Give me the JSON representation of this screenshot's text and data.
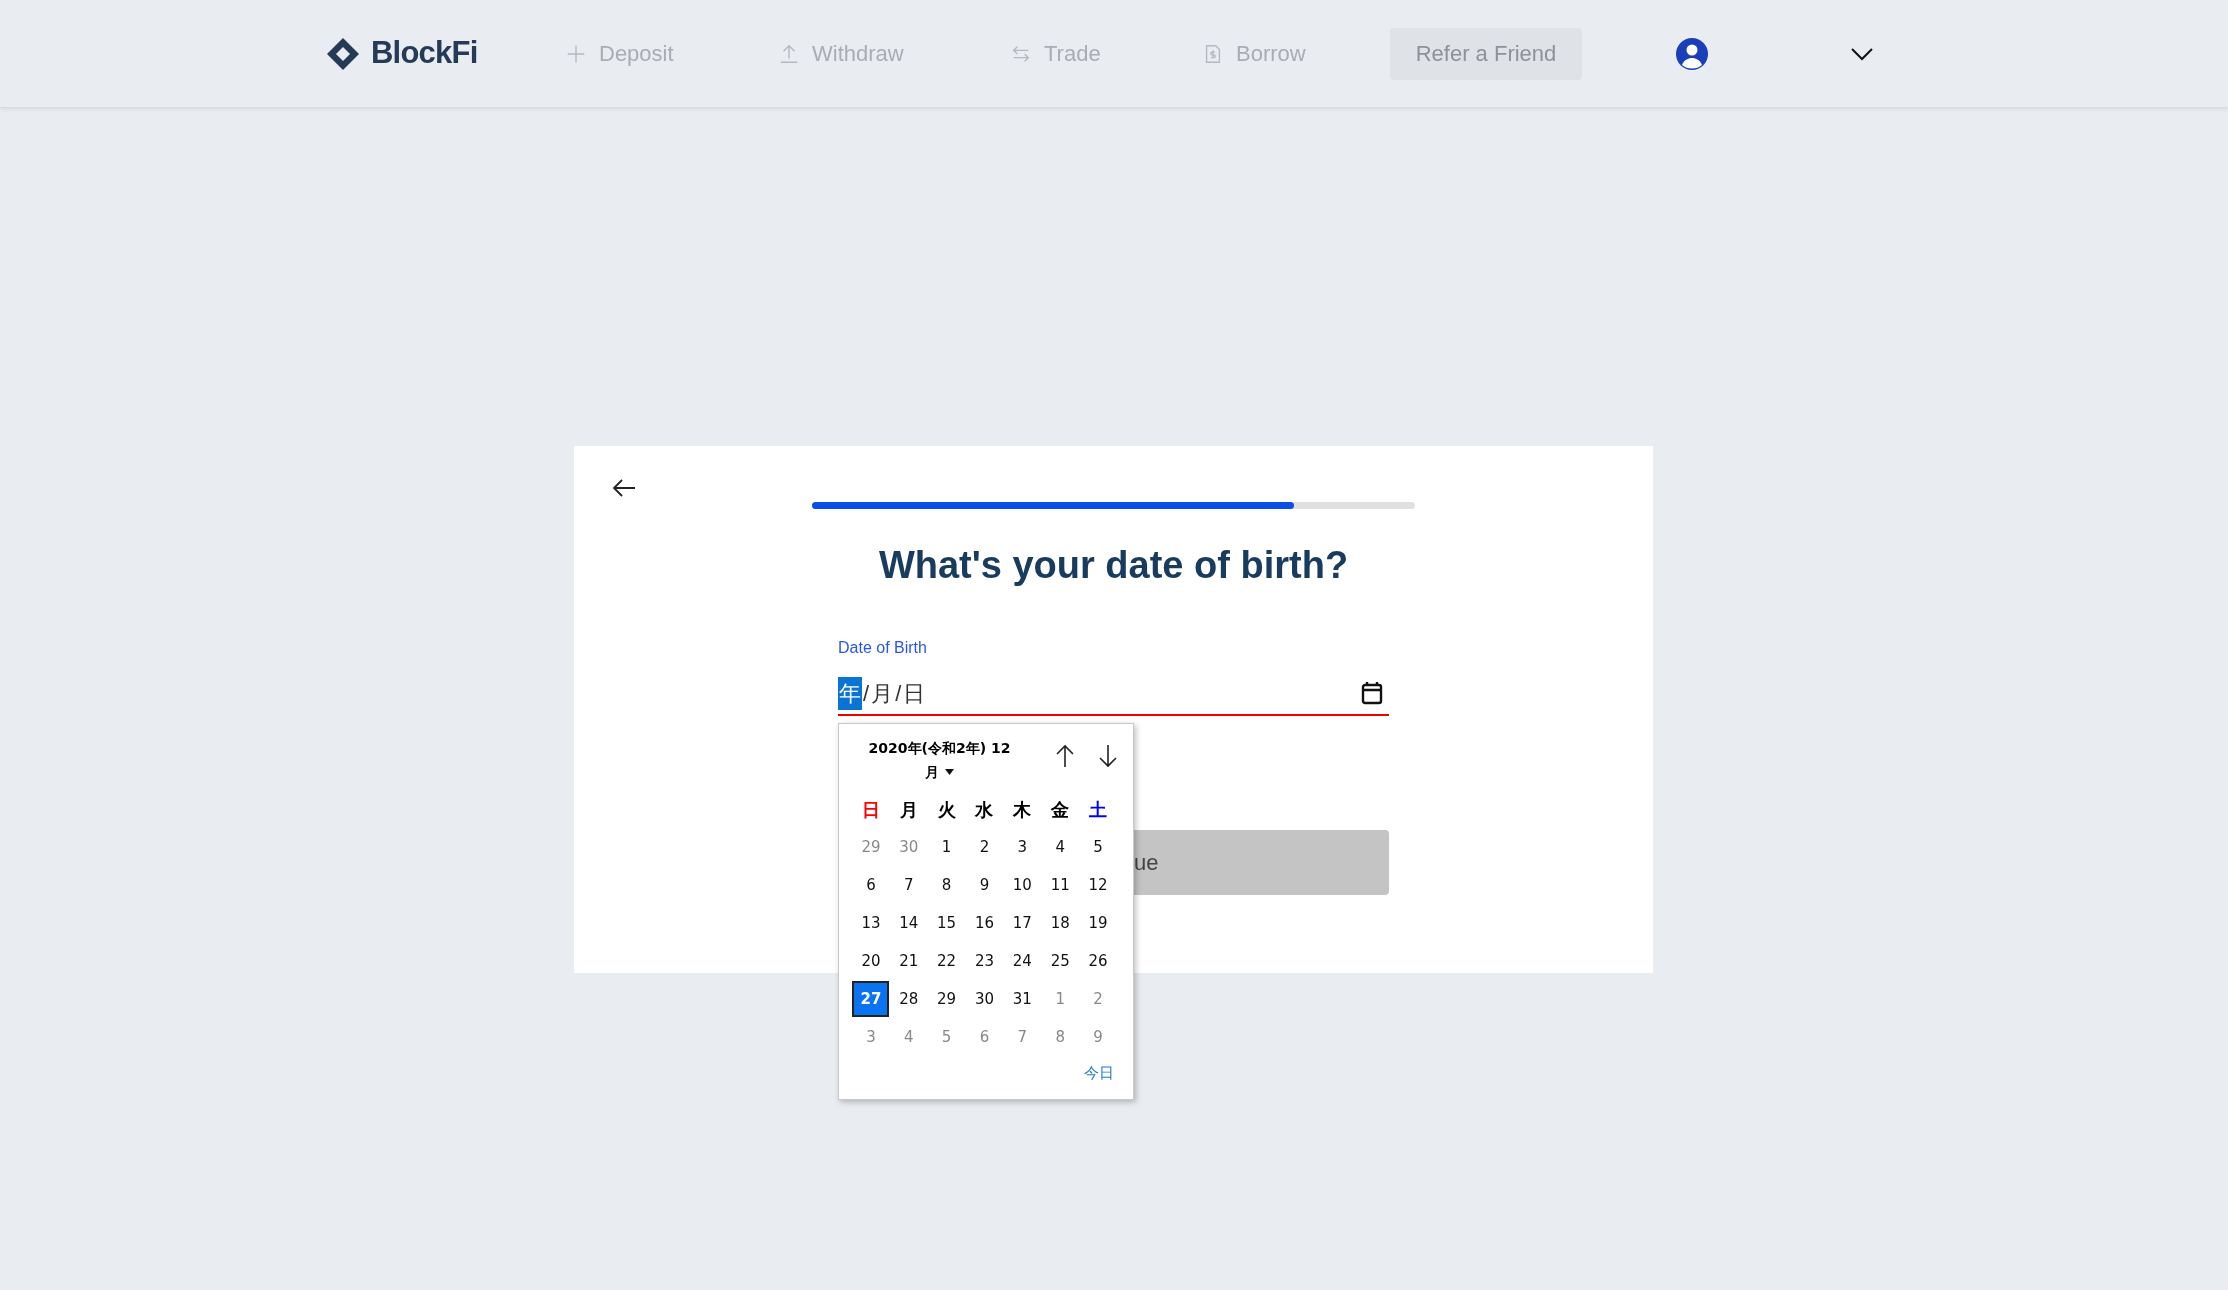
{
  "nav": {
    "logo": "BlockFi",
    "items": [
      {
        "label": "Deposit",
        "kind": "plus"
      },
      {
        "label": "Withdraw",
        "kind": "upload"
      },
      {
        "label": "Trade",
        "kind": "swap"
      },
      {
        "label": "Borrow",
        "kind": "doc"
      }
    ],
    "refer_button": "Refer a Friend"
  },
  "card": {
    "progress": {
      "level": 0.8
    },
    "title": "What's your date of birth?",
    "field": {
      "label": "Date of Birth",
      "segments": [
        {
          "text": "年",
          "selected": true
        },
        {
          "text": "/",
          "selected": false
        },
        {
          "text": "月",
          "selected": false
        },
        {
          "text": "/",
          "selected": false
        },
        {
          "text": "日",
          "selected": false
        }
      ]
    },
    "continue_button": "ue"
  },
  "calendar": {
    "header_line1": "2020年(令和2年) 12",
    "header_line2": "月",
    "weekdays": [
      {
        "label": "日",
        "color": "#ff0000"
      },
      {
        "label": "月",
        "color": "#000000"
      },
      {
        "label": "火",
        "color": "#000000"
      },
      {
        "label": "水",
        "color": "#000000"
      },
      {
        "label": "木",
        "color": "#000000"
      },
      {
        "label": "金",
        "color": "#000000"
      },
      {
        "label": "土",
        "color": "#0000ff"
      }
    ],
    "weeks": [
      [
        {
          "day": "29",
          "kind": "other",
          "selected": false
        },
        {
          "day": "30",
          "kind": "other",
          "selected": false
        },
        {
          "day": "1",
          "kind": "current",
          "selected": false
        },
        {
          "day": "2",
          "kind": "current",
          "selected": false
        },
        {
          "day": "3",
          "kind": "current",
          "selected": false
        },
        {
          "day": "4",
          "kind": "current",
          "selected": false
        },
        {
          "day": "5",
          "kind": "current",
          "selected": false
        }
      ],
      [
        {
          "day": "6",
          "kind": "current",
          "selected": false
        },
        {
          "day": "7",
          "kind": "current",
          "selected": false
        },
        {
          "day": "8",
          "kind": "current",
          "selected": false
        },
        {
          "day": "9",
          "kind": "current",
          "selected": false
        },
        {
          "day": "10",
          "kind": "current",
          "selected": false
        },
        {
          "day": "11",
          "kind": "current",
          "selected": false
        },
        {
          "day": "12",
          "kind": "current",
          "selected": false
        }
      ],
      [
        {
          "day": "13",
          "kind": "current",
          "selected": false
        },
        {
          "day": "14",
          "kind": "current",
          "selected": false
        },
        {
          "day": "15",
          "kind": "current",
          "selected": false
        },
        {
          "day": "16",
          "kind": "current",
          "selected": false
        },
        {
          "day": "17",
          "kind": "current",
          "selected": false
        },
        {
          "day": "18",
          "kind": "current",
          "selected": false
        },
        {
          "day": "19",
          "kind": "current",
          "selected": false
        }
      ],
      [
        {
          "day": "20",
          "kind": "current",
          "selected": false
        },
        {
          "day": "21",
          "kind": "current",
          "selected": false
        },
        {
          "day": "22",
          "kind": "current",
          "selected": false
        },
        {
          "day": "23",
          "kind": "current",
          "selected": false
        },
        {
          "day": "24",
          "kind": "current",
          "selected": false
        },
        {
          "day": "25",
          "kind": "current",
          "selected": false
        },
        {
          "day": "26",
          "kind": "current",
          "selected": false
        }
      ],
      [
        {
          "day": "27",
          "kind": "current",
          "selected": true
        },
        {
          "day": "28",
          "kind": "current",
          "selected": false
        },
        {
          "day": "29",
          "kind": "current",
          "selected": false
        },
        {
          "day": "30",
          "kind": "current",
          "selected": false
        },
        {
          "day": "31",
          "kind": "current",
          "selected": false
        },
        {
          "day": "1",
          "kind": "other",
          "selected": false
        },
        {
          "day": "2",
          "kind": "other",
          "selected": false
        }
      ],
      [
        {
          "day": "3",
          "kind": "other",
          "selected": false
        },
        {
          "day": "4",
          "kind": "other",
          "selected": false
        },
        {
          "day": "5",
          "kind": "other",
          "selected": false
        },
        {
          "day": "6",
          "kind": "other",
          "selected": false
        },
        {
          "day": "7",
          "kind": "other",
          "selected": false
        },
        {
          "day": "8",
          "kind": "other",
          "selected": false
        },
        {
          "day": "9",
          "kind": "other",
          "selected": false
        }
      ]
    ],
    "today": "今日"
  }
}
